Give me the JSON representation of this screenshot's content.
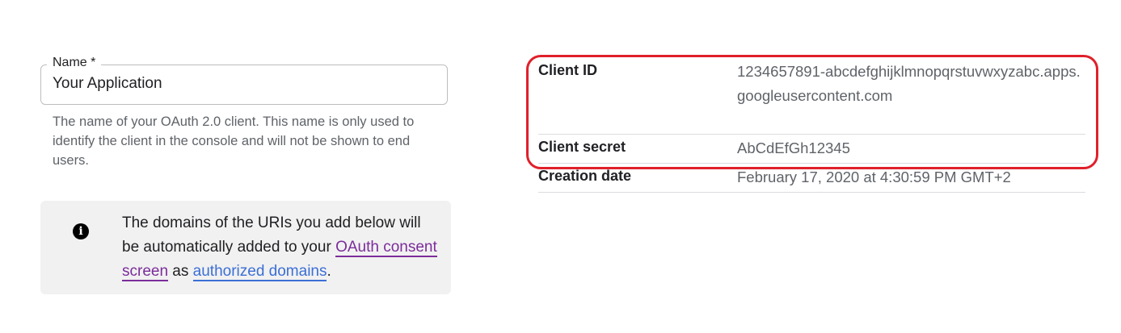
{
  "name_field": {
    "label": "Name *",
    "value": "Your Application",
    "hint": "The name of your OAuth 2.0 client. This name is only used to identify the client in the console and will not be shown to end users."
  },
  "info_box": {
    "text_before": "The domains of the URIs you add below will be automatically added to your ",
    "link_consent": "OAuth consent screen",
    "text_middle": " as ",
    "link_domains": "authorized domains",
    "text_after": ".",
    "icon": "info-icon"
  },
  "details": {
    "client_id_label": "Client ID",
    "client_id_value": "1234657891-abcdefghijklmnopqrstuvwxyzabc.apps.googleusercontent.com",
    "client_secret_label": "Client secret",
    "client_secret_value": "AbCdEfGh12345",
    "creation_date_label": "Creation date",
    "creation_date_value": "February 17, 2020 at 4:30:59 PM GMT+2"
  },
  "colors": {
    "highlight": "#e0202a",
    "link_visited": "#7b2c9b",
    "link": "#3b6fd6",
    "info_bg": "#f1f1f1"
  }
}
